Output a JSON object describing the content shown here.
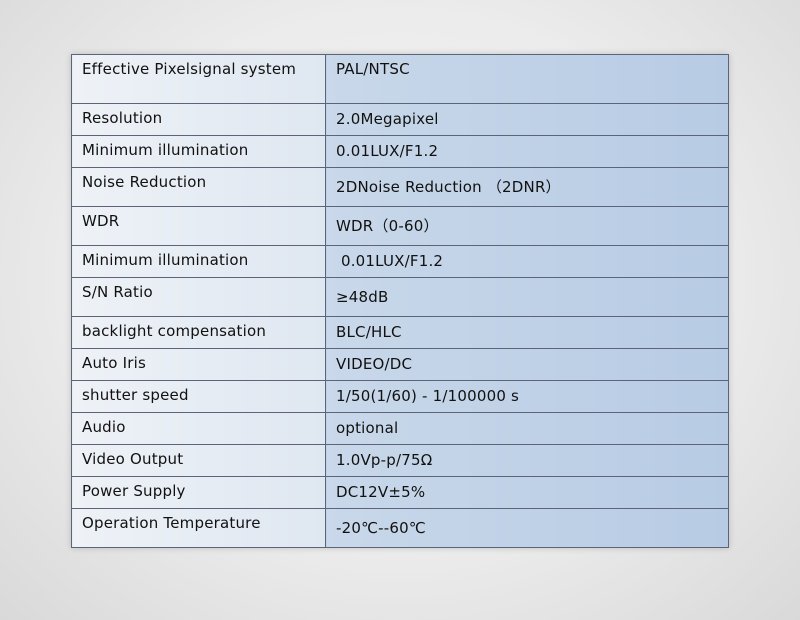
{
  "specs": [
    {
      "label": "Effective  Pixelsignal system",
      "value": "PAL/NTSC"
    },
    {
      "label": "Resolution",
      "value": "2.0Megapixel"
    },
    {
      "label": "Minimum illumination",
      "value": "0.01LUX/F1.2"
    },
    {
      "label": "Noise Reduction",
      "value": "2DNoise Reduction （2DNR）"
    },
    {
      "label": "WDR",
      "value": "WDR（0-60）"
    },
    {
      "label": "Minimum illumination",
      "value": " 0.01LUX/F1.2"
    },
    {
      "label": "S/N Ratio",
      "value": "≥48dB"
    },
    {
      "label": "backlight compensation",
      "value": "BLC/HLC"
    },
    {
      "label": "Auto Iris",
      "value": "VIDEO/DC"
    },
    {
      "label": "shutter speed",
      "value": "1/50(1/60) - 1/100000 s"
    },
    {
      "label": "Audio",
      "value": "optional"
    },
    {
      "label": "Video Output",
      "value": "1.0Vp-p/75Ω"
    },
    {
      "label": "Power Supply",
      "value": "DC12V±5%"
    },
    {
      "label": "Operation Temperature",
      "value": "-20℃--60℃"
    }
  ]
}
